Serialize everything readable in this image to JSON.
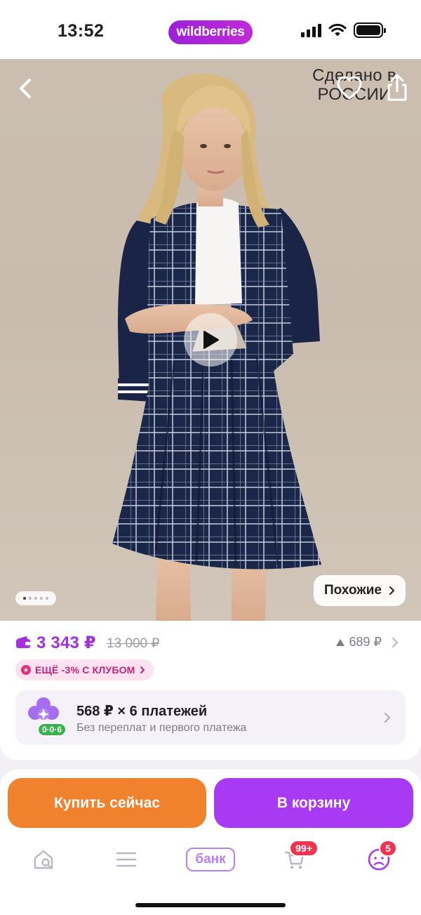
{
  "status_bar": {
    "time": "13:52",
    "brand": "wildberries",
    "icons": [
      "signal-icon",
      "wifi-icon",
      "battery-icon"
    ]
  },
  "hero": {
    "made_in": "Сделано в РОССИИ",
    "similar_label": "Похожие",
    "icons": [
      "back-icon",
      "heart-icon",
      "share-icon",
      "play-icon"
    ],
    "page_count": 5,
    "active_page": 1
  },
  "price": {
    "current": "3 343 ₽",
    "old": "13 000 ₽",
    "history": "689 ₽",
    "club_offer": "ЕЩЁ -3% С КЛУБОМ"
  },
  "installments": {
    "title": "568 ₽ × 6 платежей",
    "subtitle": "Без переплат и первого платежа",
    "tag": "0·0·6"
  },
  "actions": {
    "buy_now": "Купить сейчас",
    "add_to_cart": "В корзину"
  },
  "tab_bar": {
    "bank_label": "банк",
    "cart_badge": "99+",
    "profile_badge": "5",
    "icons": [
      "home-icon",
      "catalog-icon",
      "bank-icon",
      "cart-icon",
      "profile-icon"
    ]
  },
  "colors": {
    "brand": "#a73af2",
    "price": "#a42ee0",
    "buy_button": "#f0822d",
    "badge": "#ef3450",
    "club_badge_bg": "#fce1ef"
  }
}
